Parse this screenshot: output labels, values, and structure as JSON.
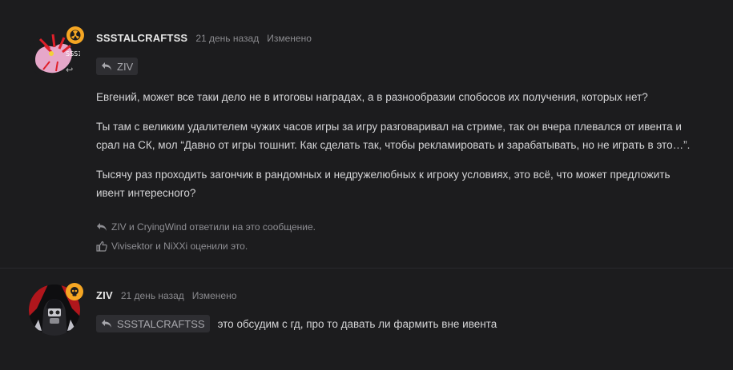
{
  "posts": [
    {
      "username": "SSSTALCRAFTSS",
      "time": "21 день назад",
      "edited": "Изменено",
      "avatar_text": "SSS1",
      "reply_to": "ZIV",
      "paragraphs": [
        "Евгений, может все таки дело не в итоговы наградах, а в разнообразии спобосов их получения, которых нет?",
        "Ты там с великим удалителем чужих часов игры за игру разговаривал на стриме, так он вчера плевался от ивента и",
        "срал на СК, мол “Давно от игры тошнит. Как сделать так, чтобы рекламировать и зарабатывать, но не играть в это…”.",
        "Тысячу раз проходить загончик в рандомных и недружелюбных к игроку условиях, это всё, что может предложить",
        "ивент интересного?"
      ],
      "replies_text": "ZIV и CryingWind ответили на это сообщение.",
      "likes_text": "Vivisektor и NiXXi оценили это.",
      "colors": {
        "badge": "#f5a623"
      }
    },
    {
      "username": "ZIV",
      "time": "21 день назад",
      "edited": "Изменено",
      "reply_to": "SSSTALCRAFTSS",
      "text": "это обсудим с гд, про то давать ли фармить вне ивента",
      "colors": {
        "badge": "#f5a623"
      }
    }
  ]
}
